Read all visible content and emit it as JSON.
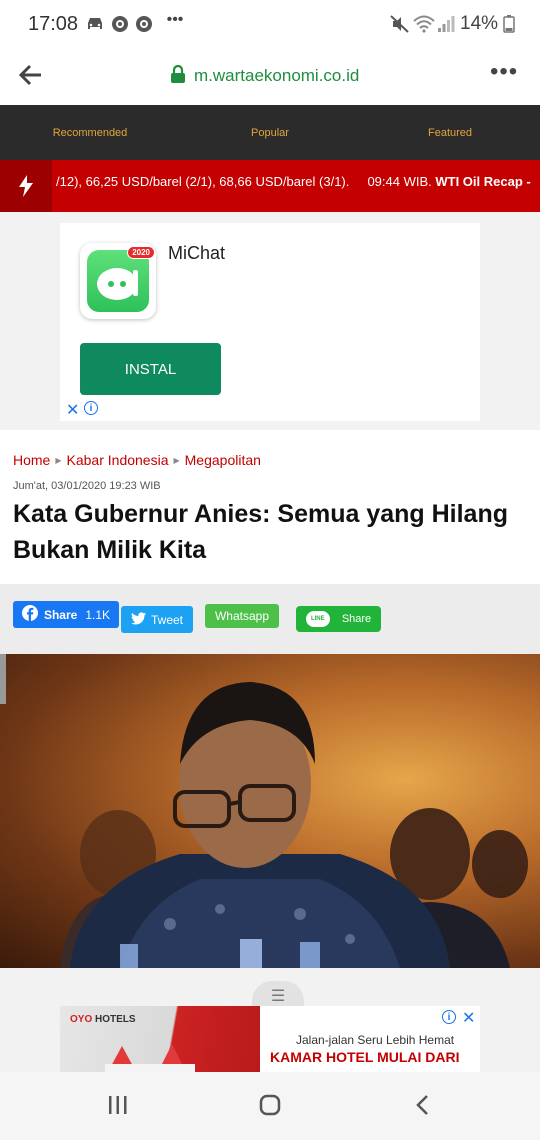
{
  "status_bar": {
    "time": "17:08",
    "battery": "14%",
    "icons": [
      "car-icon",
      "record-icon",
      "record-icon",
      "more-dots-icon",
      "mute-vibrate-icon",
      "wifi-icon",
      "signal-icon",
      "battery-icon"
    ]
  },
  "browser": {
    "url": "m.wartaekonomi.co.id",
    "back_icon": "back-arrow-icon",
    "lock_icon": "lock-icon",
    "menu_icon": "more-dots-icon"
  },
  "nav_tabs": [
    {
      "label": "Recommended"
    },
    {
      "label": "Popular"
    },
    {
      "label": "Featured"
    }
  ],
  "ticker": {
    "text": "/12), 66,25 USD/barel (2/1), 68,66 USD/barel (3/1).",
    "time": "09:44 WIB.",
    "headline": "WTI Oil Recap -"
  },
  "ad_top": {
    "app_name": "MiChat",
    "badge": "2020",
    "install_label": "INSTAL"
  },
  "article": {
    "breadcrumb": [
      "Home",
      "Kabar Indonesia",
      "Megapolitan"
    ],
    "date": "Jum'at, 03/01/2020 19:23 WIB",
    "title": "Kata Gubernur Anies: Semua yang Hilang Bukan Milik Kita"
  },
  "share": {
    "facebook_label": "Share",
    "facebook_count": "1.1K",
    "twitter_label": "Tweet",
    "whatsapp_label": "Whatsapp",
    "line_label": "Share",
    "line_badge": "LINE"
  },
  "ad_bottom": {
    "brand": "OYO",
    "brand_suffix": "HOTELS",
    "line1": "Jalan-jalan Seru Lebih Hemat",
    "line2": "KAMAR HOTEL MULAI DARI"
  },
  "colors": {
    "nav_bg": "#2b2b2b",
    "nav_text": "#e5a43a",
    "ticker_bg": "#c40000",
    "link_red": "#c40000",
    "install_green": "#0f8a5f",
    "facebook": "#1877f2",
    "twitter": "#1da1f2",
    "whatsapp": "#4cc049",
    "line": "#22b33a"
  }
}
